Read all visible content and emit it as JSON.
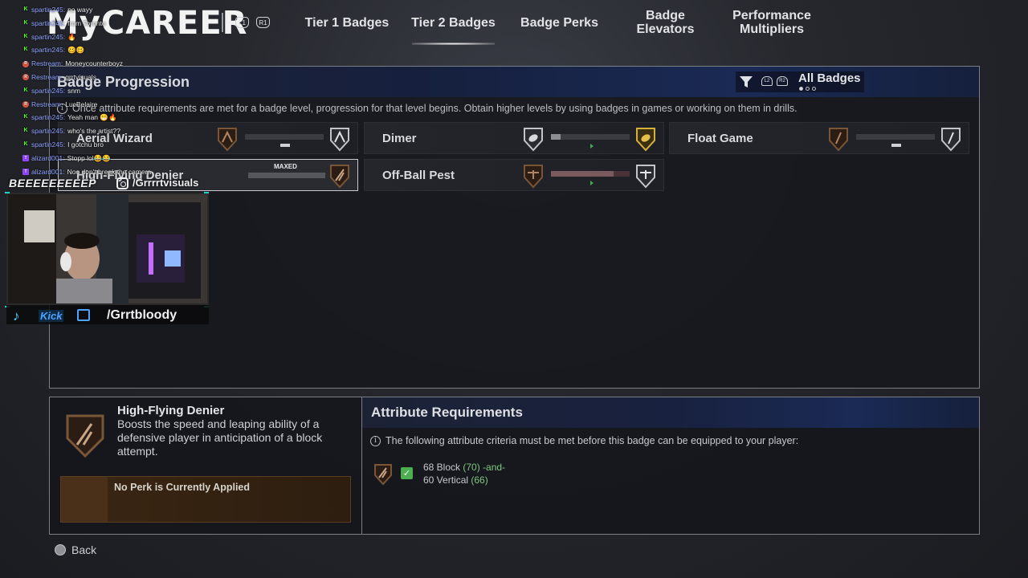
{
  "header": {
    "logo": "MyCAREER",
    "bumpers": [
      "L1",
      "R1"
    ],
    "tabs": [
      {
        "label": "Tier 1 Badges",
        "active": false
      },
      {
        "label": "Tier 2 Badges",
        "active": true
      },
      {
        "label": "Badge Perks",
        "active": false
      },
      {
        "label": "Badge\nElevators",
        "active": false
      },
      {
        "label": "Performance\nMultipliers",
        "active": false
      }
    ]
  },
  "panel": {
    "title": "Badge Progression",
    "filter_triggers": [
      "L2",
      "R2"
    ],
    "filter_label": "All Badges",
    "page_dots": 3,
    "active_dot": 1,
    "info": "Once attribute requirements are met for a badge level, progression for that level begins. Obtain higher levels by using badges in games or working on them in drills."
  },
  "badges": [
    {
      "name": "Aerial Wizard",
      "progress": 0,
      "status": "",
      "tier": "bronze"
    },
    {
      "name": "Dimer",
      "progress": 0.08,
      "status": "",
      "tier": "gold"
    },
    {
      "name": "Float Game",
      "progress": 0,
      "status": "",
      "tier": "bronze"
    },
    {
      "name": "High-Flying Denier",
      "progress": 1.0,
      "status": "MAXED",
      "tier": "bronze",
      "selected": true
    },
    {
      "name": "Off-Ball Pest",
      "progress": 0.8,
      "status": "",
      "tier": "bronze"
    }
  ],
  "detail": {
    "name": "High-Flying Denier",
    "description": "Boosts the speed and leaping ability of a defensive player in anticipation of a block attempt.",
    "perk": "No Perk is Currently Applied"
  },
  "requirements": {
    "title": "Attribute Requirements",
    "info": "The following attribute criteria must be met before this badge can be equipped to your player:",
    "line1": {
      "text": "68 Block ",
      "value": "(70)",
      "suffix": " -and-"
    },
    "line2": {
      "text": "60 Vertical ",
      "value": "(66)"
    }
  },
  "footer": {
    "back": "Back"
  },
  "overlay": {
    "chat": [
      {
        "platform": "kick",
        "user": "spartin245:",
        "msg": "no wayy"
      },
      {
        "platform": "kick",
        "user": "spartin245:",
        "msg": "from Toronto"
      },
      {
        "platform": "kick",
        "user": "spartin245:",
        "msg": "🔥"
      },
      {
        "platform": "kick",
        "user": "spartin245:",
        "msg": "🥴🥴"
      },
      {
        "platform": "restream",
        "user": "Restream:",
        "msg": "Moneycounterboyz"
      },
      {
        "platform": "restream",
        "user": "Restream:",
        "msg": "grrtvisuals"
      },
      {
        "platform": "kick",
        "user": "spartin245:",
        "msg": "snm"
      },
      {
        "platform": "restream",
        "user": "Restream:",
        "msg": "LucBelaire"
      },
      {
        "platform": "kick",
        "user": "spartin245:",
        "msg": "Yeah man 😁🔥"
      },
      {
        "platform": "kick",
        "user": "spartin245:",
        "msg": "who's the artist??"
      },
      {
        "platform": "kick",
        "user": "spartin245:",
        "msg": "I gotchu bro"
      },
      {
        "platform": "twitch",
        "user": "alizard001:",
        "msg": "Stopp lol😂😂"
      },
      {
        "platform": "twitch",
        "user": "alizard001:",
        "msg": "Noo don't break the camera"
      }
    ],
    "cam_name": "BEEEEEEEEEP",
    "instagram_handle": "/Grrrrtvisuals",
    "kick_label": "Kick",
    "twitch_handle": "/Grrtbloody"
  }
}
